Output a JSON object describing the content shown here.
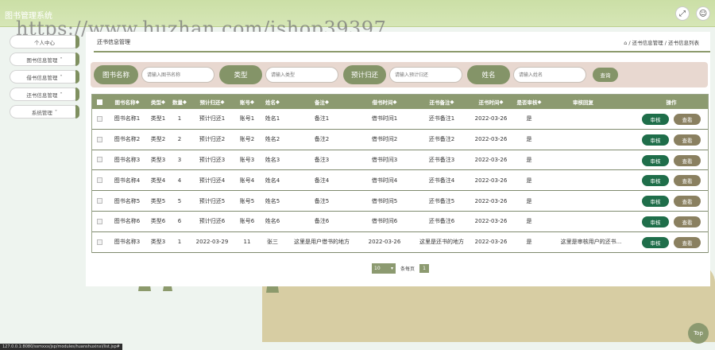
{
  "app": {
    "title": "图书管理系统",
    "watermark": "https://www.huzhan.com/ishop39397",
    "status_url": "127.0.0.1:8080/ssmxxx/jsp/modules/huanshuxinxi/list.jsp#"
  },
  "sidebar": {
    "items": [
      {
        "label": "个人中心"
      },
      {
        "label": "图书信息管理"
      },
      {
        "label": "借书信息管理"
      },
      {
        "label": "还书信息管理"
      },
      {
        "label": "系统管理"
      }
    ]
  },
  "breadcrumb": {
    "title": "还书信息管理",
    "path": "/ 还书信息管理 / 还书信息列表"
  },
  "search": {
    "fields": [
      {
        "label": "图书名称",
        "placeholder": "请输入图书名称"
      },
      {
        "label": "类型",
        "placeholder": "请输入类型"
      },
      {
        "label": "预计归还",
        "placeholder": "请输入预计归还"
      },
      {
        "label": "姓名",
        "placeholder": "请输入姓名"
      }
    ],
    "button": "查询"
  },
  "table": {
    "headers": [
      "图书名称",
      "类型",
      "数量",
      "预计归还",
      "账号",
      "姓名",
      "备注",
      "借书时间",
      "还书备注",
      "还书时间",
      "是否审核",
      "审核回复",
      "操作"
    ],
    "rows": [
      [
        "图书名称1",
        "类型1",
        "1",
        "预计归还1",
        "账号1",
        "姓名1",
        "备注1",
        "借书时间1",
        "还书备注1",
        "2022-03-26",
        "是",
        ""
      ],
      [
        "图书名称2",
        "类型2",
        "2",
        "预计归还2",
        "账号2",
        "姓名2",
        "备注2",
        "借书时间2",
        "还书备注2",
        "2022-03-26",
        "是",
        ""
      ],
      [
        "图书名称3",
        "类型3",
        "3",
        "预计归还3",
        "账号3",
        "姓名3",
        "备注3",
        "借书时间3",
        "还书备注3",
        "2022-03-26",
        "是",
        ""
      ],
      [
        "图书名称4",
        "类型4",
        "4",
        "预计归还4",
        "账号4",
        "姓名4",
        "备注4",
        "借书时间4",
        "还书备注4",
        "2022-03-26",
        "是",
        ""
      ],
      [
        "图书名称5",
        "类型5",
        "5",
        "预计归还5",
        "账号5",
        "姓名5",
        "备注5",
        "借书时间5",
        "还书备注5",
        "2022-03-26",
        "是",
        ""
      ],
      [
        "图书名称6",
        "类型6",
        "6",
        "预计归还6",
        "账号6",
        "姓名6",
        "备注6",
        "借书时间6",
        "还书备注6",
        "2022-03-26",
        "是",
        ""
      ],
      [
        "图书名称3",
        "类型3",
        "1",
        "2022-03-29",
        "11",
        "张三",
        "这里是用户借书的地方",
        "2022-03-26",
        "这里是还书的地方",
        "2022-03-26",
        "是",
        "这里是审核用户的还书..."
      ]
    ],
    "action_review": "审核",
    "action_view": "查看"
  },
  "pagination": {
    "page_size": "10",
    "per_page_text": "条每页",
    "current_page": "1"
  },
  "top_button": "Top",
  "colors": {
    "accent": "#8c9a70",
    "review_button": "#1f6e4a",
    "view_button": "#8a8060",
    "header_bar": "#cbdfa6"
  }
}
